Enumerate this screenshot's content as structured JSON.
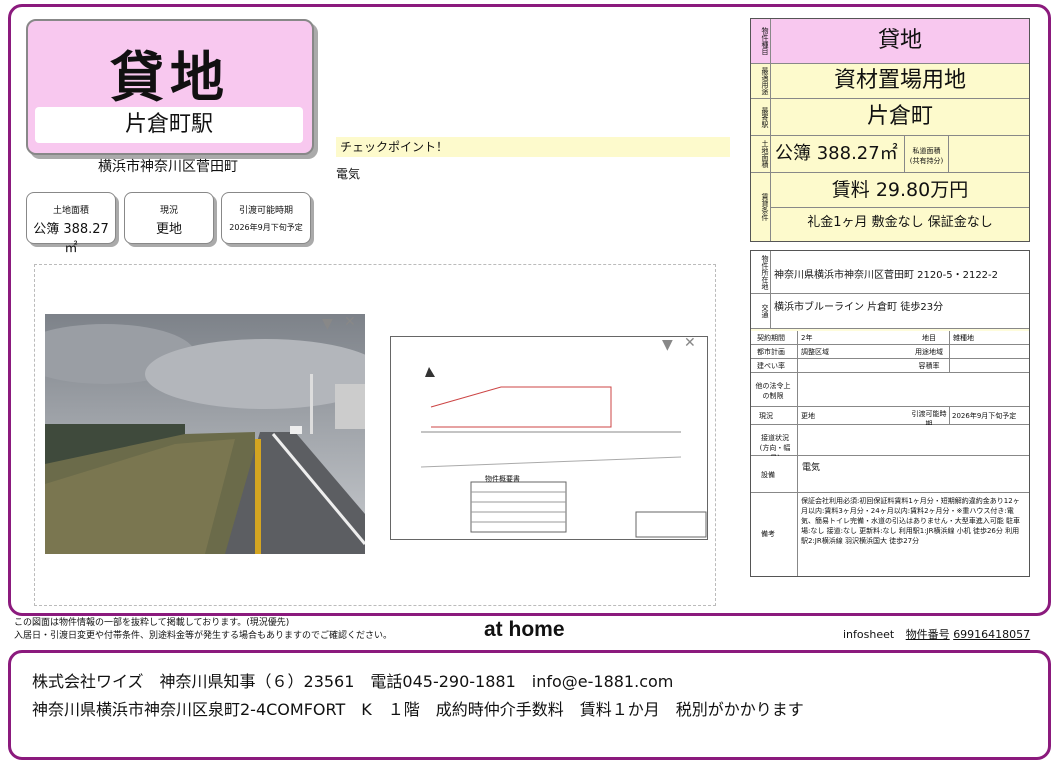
{
  "title": {
    "main": "貸地",
    "station": "片倉町駅",
    "address": "横浜市神奈川区菅田町"
  },
  "summary": [
    {
      "label": "土地面積",
      "value": "公簿 388.27㎡"
    },
    {
      "label": "現況",
      "value": "更地"
    },
    {
      "label": "引渡可能時期",
      "value": "2026年9月下旬予定"
    }
  ],
  "checkpoint": {
    "label": "チェックポイント！",
    "text": "電気"
  },
  "spec": {
    "type_label": "物件種目",
    "type": "貸地",
    "use_label": "最適用途",
    "use": "資材置場用地",
    "station_label": "最寄駅",
    "station": "片倉町",
    "area_label": "土地面積",
    "area": "公簿 388.27㎡",
    "private_road_label": "私道面積",
    "private_road_sub": "(共有持分)",
    "rent_label": "賃貸条件",
    "rent": "賃料 29.80万円",
    "terms": "礼金1ヶ月  敷金なし  保証金なし"
  },
  "info": {
    "location_label": "物件所在地",
    "location": "神奈川県横浜市神奈川区菅田町 2120-5・2122-2",
    "transport_label": "交通",
    "transport": "横浜市ブルーライン 片倉町 徒歩23分",
    "contract_label": "契約期間",
    "contract": "2年",
    "land_label": "地目",
    "land": "雑種地",
    "city_plan_label": "都市計画",
    "city_plan": "調整区域",
    "zoning_label": "用途地域",
    "zoning": "",
    "coverage_label": "建ぺい率",
    "coverage": "",
    "far_label": "容積率",
    "far": "",
    "restriction_label": "他の法令上の制限",
    "restriction": "",
    "status_label": "現況",
    "status": "更地",
    "handover_label": "引渡可能時期",
    "handover": "2026年9月下旬予定",
    "road_label": "接道状況",
    "road_sub": "(方向・幅員)",
    "road": "",
    "equipment_label": "設備",
    "equipment": "電気",
    "remarks_label": "備考",
    "remarks": "保証会社利用必須:初回保証料賃料1ヶ月分・短期解約違約金あり12ヶ月以内:賃料3ヶ月分・24ヶ月以内:賃料2ヶ月分・※重ハウス付き:電気、簡易トイレ完備・水道の引込はありません・大型車進入可能 駐車場:なし 接道:なし 更新料:なし 利用駅1:JR横浜線 小机 徒歩26分 利用駅2:JR横浜線 羽沢横浜国大 徒歩27分"
  },
  "drawing": {
    "title": "物件概要書"
  },
  "footer": {
    "note1": "この図面は物件情報の一部を抜粋して掲載しております。(現況優先)",
    "note2": "入居日・引渡日変更や付帯条件、別途料金等が発生する場合もありますのでご確認ください。",
    "brand": "at home",
    "infosheet": "infosheet",
    "id_label": "物件番号",
    "id": "69916418057"
  },
  "company": {
    "line1": "株式会社ワイズ　神奈川県知事（６）23561　電話045-290-1881　info@e-1881.com",
    "line2": "神奈川県横浜市神奈川区泉町2-4COMFORT　K　１階　成約時仲介手数料　賃料１か月　税別がかかります"
  },
  "colors": {
    "frame": "#8b1a7d",
    "pink": "#f8c8ef",
    "cream": "#fdfacc"
  }
}
